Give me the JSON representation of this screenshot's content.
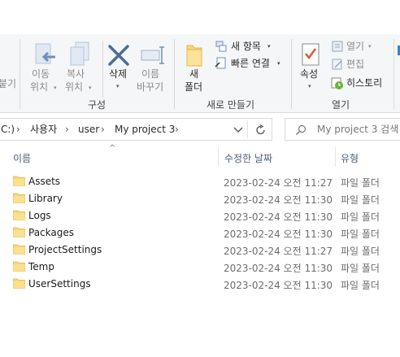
{
  "ribbon": {
    "partial_left_label": "붙기",
    "organize": {
      "group_label": "구성",
      "move_to": [
        "이동",
        "위치"
      ],
      "copy_to": [
        "복사",
        "위치"
      ],
      "delete": "삭제",
      "rename": [
        "이름",
        "바꾸기"
      ]
    },
    "new": {
      "group_label": "새로 만들기",
      "new_folder": [
        "새",
        "폴더"
      ],
      "new_item": "새 항목",
      "easy_access": "빠른 연결"
    },
    "open": {
      "group_label": "열기",
      "properties": "속성",
      "open": "열기",
      "edit": "편집",
      "history": "히스토리"
    }
  },
  "address": {
    "path": [
      "C:)",
      "사용자",
      "user",
      "My project 3"
    ],
    "search_placeholder": "My project 3 검색"
  },
  "columns": {
    "name": "이름",
    "date_modified": "수정한 날짜",
    "type": "유형"
  },
  "files": [
    {
      "name": "Assets",
      "date": "2023-02-24 오전 11:27",
      "type": "파일 폴더"
    },
    {
      "name": "Library",
      "date": "2023-02-24 오전 11:30",
      "type": "파일 폴더"
    },
    {
      "name": "Logs",
      "date": "2023-02-24 오전 11:30",
      "type": "파일 폴더"
    },
    {
      "name": "Packages",
      "date": "2023-02-24 오전 11:30",
      "type": "파일 폴더"
    },
    {
      "name": "ProjectSettings",
      "date": "2023-02-24 오전 11:27",
      "type": "파일 폴더"
    },
    {
      "name": "Temp",
      "date": "2023-02-24 오전 11:30",
      "type": "파일 폴더"
    },
    {
      "name": "UserSettings",
      "date": "2023-02-24 오전 11:30",
      "type": "파일 폴더"
    }
  ],
  "colors": {
    "ribbon_bg": "#f5f6f7",
    "folder_yellow": "#f8d775",
    "header_text": "#4c607a",
    "delete_blue": "#4a6e96"
  }
}
